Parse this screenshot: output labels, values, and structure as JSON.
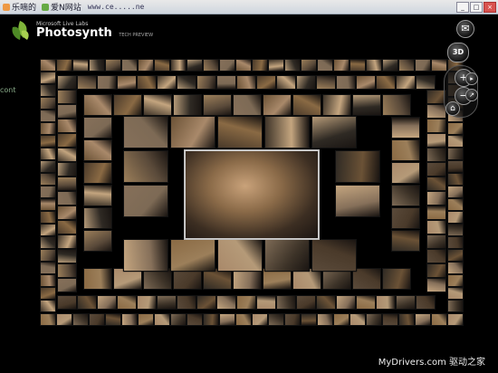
{
  "browser": {
    "tabs": [
      {
        "label": "乐嘀的"
      },
      {
        "label": "爱N网站"
      }
    ],
    "url": "www.ce.....ne",
    "window_buttons": [
      "_",
      "□",
      "×"
    ]
  },
  "app": {
    "logo_sub": "Microsoft Live Labs",
    "logo_main": "Photosynth",
    "logo_preview": "TECH PREVIEW"
  },
  "controls": {
    "envelope": "✉",
    "three_d": "3D",
    "plus": "+",
    "minus": "−",
    "home": "⌂",
    "arrow_right": "▸",
    "arrow_up_right": "↗"
  },
  "colors": {
    "background": "#000000",
    "thumb_palette": [
      "#6b5236",
      "#8a6a44",
      "#4a3a2a",
      "#a9896a",
      "#3d3328",
      "#7d6a55",
      "#b59a78",
      "#5a4a3a",
      "#9c7f5a",
      "#2f2a24",
      "#86705a",
      "#c4a57f"
    ]
  },
  "watermark": "MyDrivers.com 驱动之家",
  "edge_text": "cont"
}
